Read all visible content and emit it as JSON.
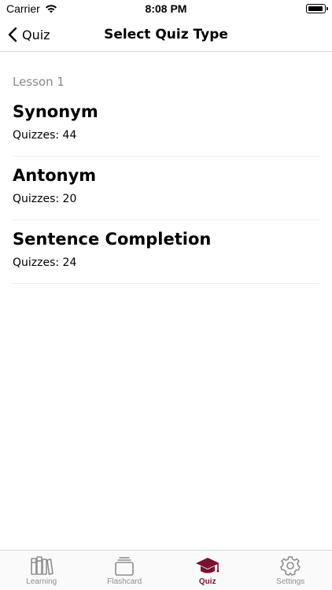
{
  "status_bar": {
    "carrier": "Carrier",
    "time": "8:08 PM"
  },
  "nav": {
    "back_label": "Quiz",
    "title": "Select Quiz Type"
  },
  "section": {
    "header": "Lesson 1"
  },
  "quiz_types": [
    {
      "title": "Synonym",
      "count": "Quizzes: 44"
    },
    {
      "title": "Antonym",
      "count": "Quizzes: 20"
    },
    {
      "title": "Sentence Completion",
      "count": "Quizzes: 24"
    }
  ],
  "tab_bar": {
    "tabs": [
      {
        "label": "Learning",
        "icon": "books-icon"
      },
      {
        "label": "Flashcard",
        "icon": "cards-icon"
      },
      {
        "label": "Quiz",
        "icon": "graduation-cap-icon",
        "active": true
      },
      {
        "label": "Settings",
        "icon": "gear-icon"
      }
    ]
  },
  "colors": {
    "accent": "#7a1030",
    "inactive": "#8e8e8e",
    "separator": "#ececec"
  }
}
